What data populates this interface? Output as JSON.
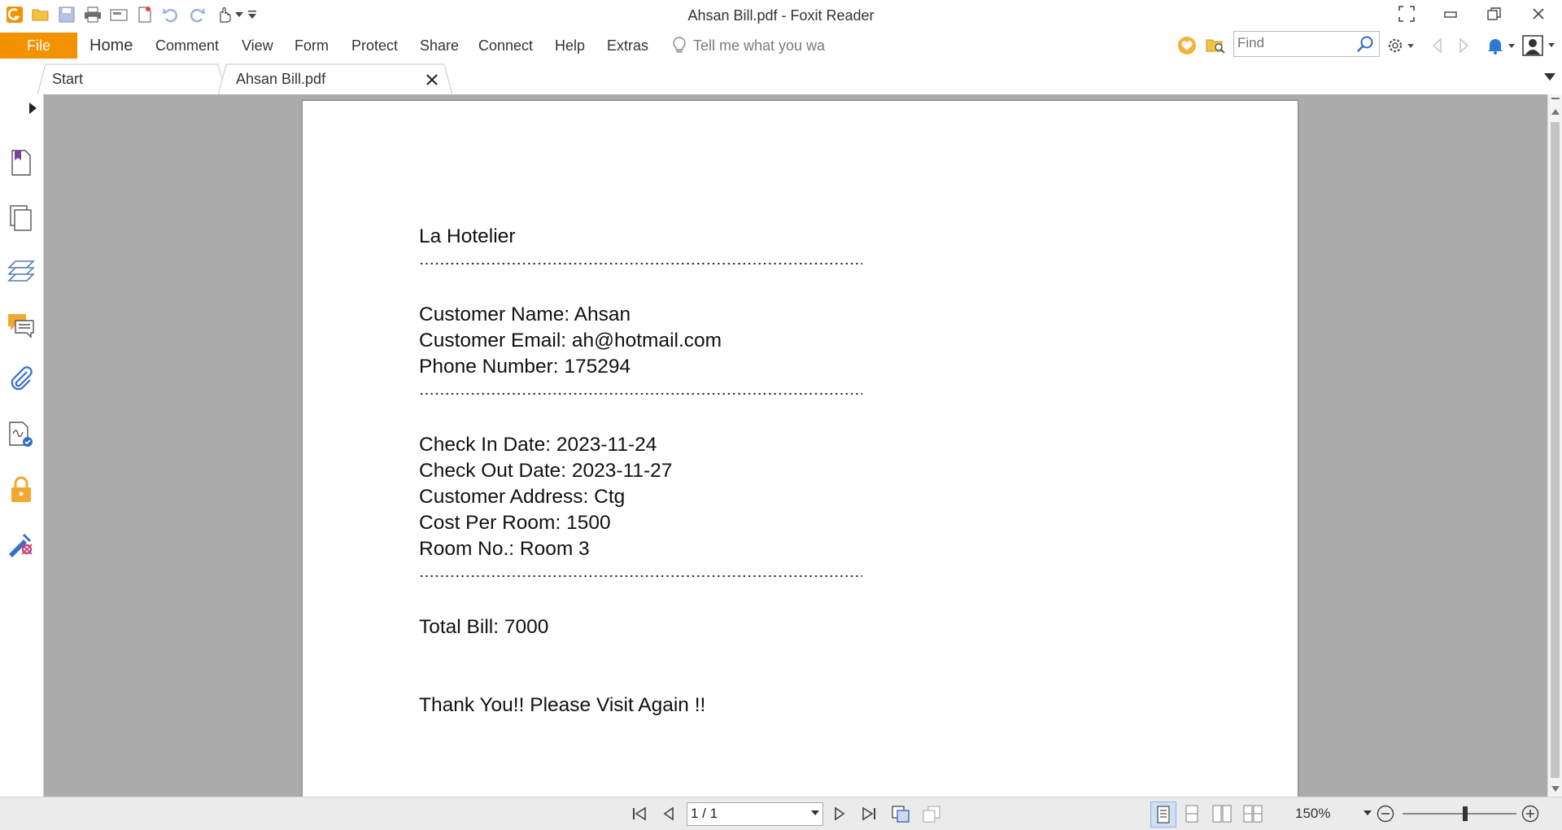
{
  "window": {
    "title": "Ahsan Bill.pdf - Foxit Reader"
  },
  "quick_access": [
    "app-logo-icon",
    "open-icon",
    "save-icon",
    "print-icon",
    "scan-icon",
    "new-icon",
    "undo-icon",
    "redo-icon",
    "hand-tool-icon",
    "customize-dropdown-icon"
  ],
  "menu": {
    "file": "File",
    "items": [
      "Home",
      "Comment",
      "View",
      "Form",
      "Protect",
      "Share",
      "Connect",
      "Help",
      "Extras"
    ],
    "tell_me": "Tell me what you want to do"
  },
  "search": {
    "placeholder": "Find"
  },
  "tabs": [
    {
      "label": "Start"
    },
    {
      "label": "Ahsan Bill.pdf",
      "active": true
    }
  ],
  "document": {
    "lines": {
      "hotel": "La Hotelier",
      "name": "Customer Name: Ahsan",
      "email": "Customer Email: ah@hotmail.com",
      "phone": "Phone Number: 175294",
      "checkin": "Check In Date: 2023-11-24",
      "checkout": "Check Out Date: 2023-11-27",
      "address": "Customer Address: Ctg",
      "cost": "Cost Per Room: 1500",
      "room": "Room No.: Room 3",
      "total": "Total Bill: 7000",
      "thanks": "Thank You!! Please Visit Again !!"
    }
  },
  "status": {
    "page": "1 / 1",
    "zoom": "150%",
    "zoom_fraction": 0.55
  },
  "colors": {
    "accent": "#f39200",
    "doc_background": "#ababab"
  }
}
